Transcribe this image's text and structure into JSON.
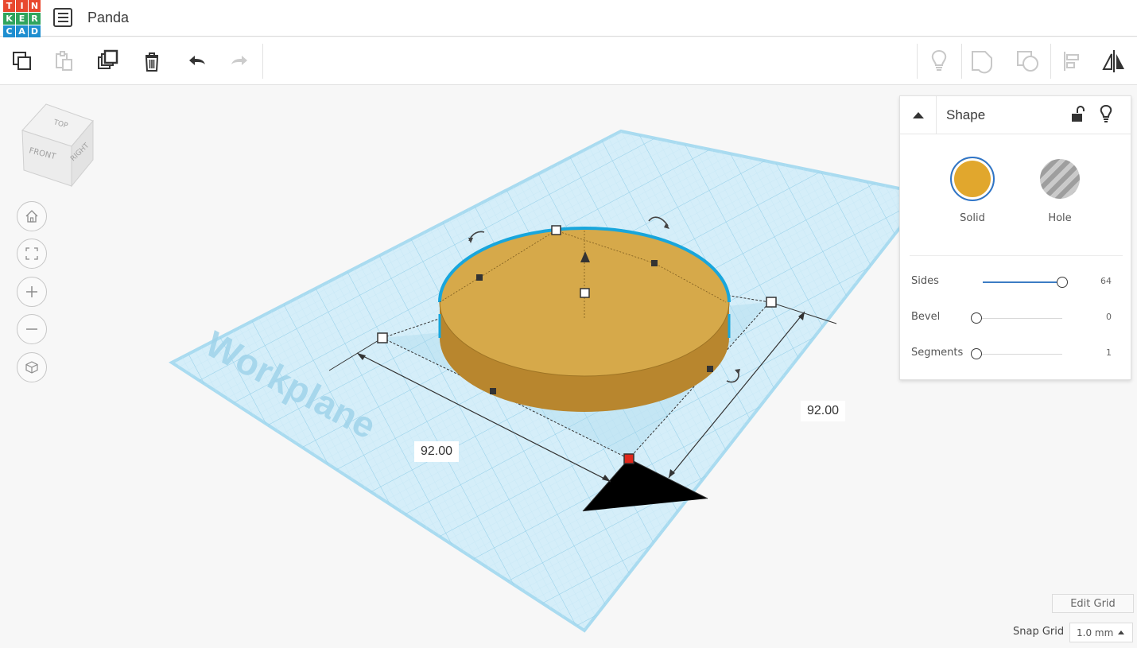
{
  "app": {
    "logo_letters": [
      "T",
      "I",
      "N",
      "K",
      "E",
      "R",
      "C",
      "A",
      "D"
    ],
    "logo_colors": [
      "#e8482e",
      "#e8482e",
      "#e8482e",
      "#2fa45d",
      "#2fa45d",
      "#2fa45d",
      "#1e8ed0",
      "#1e8ed0",
      "#1e8ed0"
    ],
    "design_title": "Panda"
  },
  "toolbar": {
    "left_icons": [
      "copy-icon",
      "paste-icon",
      "duplicate-icon",
      "delete-icon",
      "undo-icon",
      "redo-icon"
    ],
    "right_icons": [
      "lightbulb-icon",
      "group-icon",
      "ungroup-icon",
      "align-icon",
      "mirror-icon"
    ]
  },
  "viewcube": {
    "top": "TOP",
    "front": "FRONT",
    "right": "RIGHT"
  },
  "nav_buttons": [
    "home-view-icon",
    "fit-view-icon",
    "zoom-in-icon",
    "zoom-out-icon",
    "ortho-view-icon"
  ],
  "workplane": {
    "label": "Workplane",
    "color": "#8fd0ec",
    "shape_color": "#d4a441",
    "selection_outline_color": "#1aa9de"
  },
  "dimensions": {
    "width": "92.00",
    "depth": "92.00"
  },
  "inspector": {
    "title": "Shape",
    "solid_label": "Solid",
    "hole_label": "Hole",
    "solid_color": "#e1a72d",
    "params": [
      {
        "label": "Sides",
        "value": "64",
        "fraction": 1.0
      },
      {
        "label": "Bevel",
        "value": "0",
        "fraction": 0.0
      },
      {
        "label": "Segments",
        "value": "1",
        "fraction": 0.0
      }
    ]
  },
  "grid": {
    "edit_label": "Edit Grid",
    "snap_label": "Snap Grid",
    "snap_value": "1.0 mm"
  }
}
